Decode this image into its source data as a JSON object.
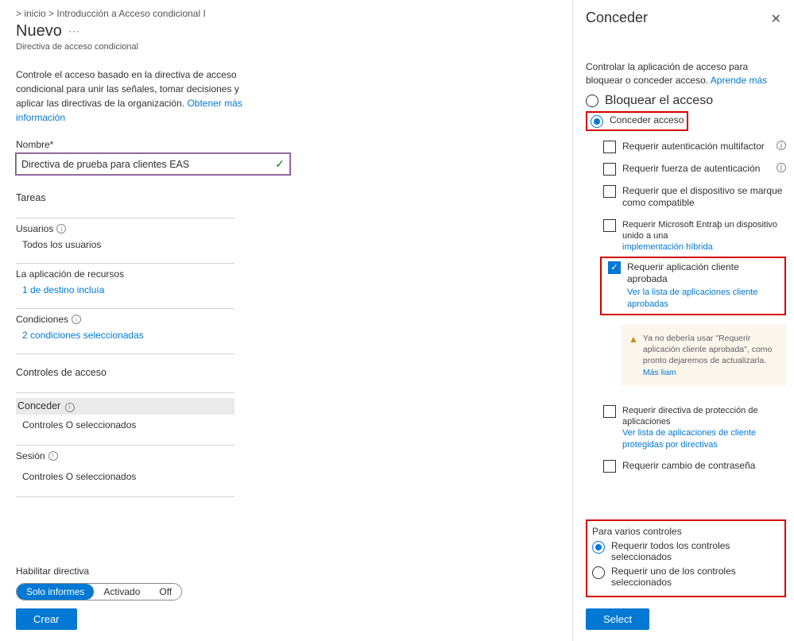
{
  "breadcrumb": "> inicio > Introducción a Acceso condicional I",
  "title": "Nuevo",
  "subtitle": "Directiva de acceso condicional",
  "description_text": "Controle el acceso basado en la directiva de acceso condicional para unir las señales, tomar decisiones y aplicar las directivas de la organización.",
  "description_link": "Obtener más información",
  "name_label": "Nombre*",
  "name_value": "Directiva de prueba para clientes EAS",
  "tasks_heading": "Tareas",
  "users": {
    "label": "Usuarios",
    "value": "Todos los usuarios"
  },
  "apps": {
    "label": "La aplicación de recursos",
    "value": "1 de destino incluía"
  },
  "conditions": {
    "label": "Condiciones",
    "value": "2 condiciones seleccionadas"
  },
  "access_heading": "Controles de acceso",
  "grant": {
    "label": "Conceder",
    "value": "Controles O seleccionados"
  },
  "session": {
    "label": "Sesión",
    "value": "Controles O seleccionados"
  },
  "enable_label": "Habilitar directiva",
  "toggle": {
    "report": "Solo informes",
    "on": "Activado",
    "off": "Off"
  },
  "create_btn": "Crear",
  "panel": {
    "title": "Conceder",
    "desc": "Controlar la aplicación de acceso para bloquear o conceder acceso.",
    "learn_more": "Aprende más",
    "block": "Bloquear el acceso",
    "grant": "Conceder acceso",
    "opts": {
      "mfa": "Requerir autenticación multifactor",
      "auth_strength": "Requerir fuerza de autenticación",
      "compliant": "Requerir que el dispositivo se marque como compatible",
      "hybrid": "Requerir Microsoft Entraþ un dispositivo unido a una",
      "hybrid_link": "implementación híbrida",
      "approved": "Requerir aplicación cliente aprobada",
      "approved_link": "Ver la lista de aplicaciones cliente aprobadas",
      "protection": "Requerir directiva de protección de aplicaciones",
      "protection_link": "Ver lista de aplicaciones de cliente protegidas por directivas",
      "password": "Requerir cambio de contraseña"
    },
    "warning": "Ya no debería usar \"Requerir aplicación cliente aprobada\", como pronto dejaremos de actualizarla.",
    "warning_link": "Más liam",
    "multi_heading": "Para varios controles",
    "multi_all": "Requerir todos los controles seleccionados",
    "multi_one": "Requerir uno de los controles seleccionados",
    "select_btn": "Select"
  }
}
